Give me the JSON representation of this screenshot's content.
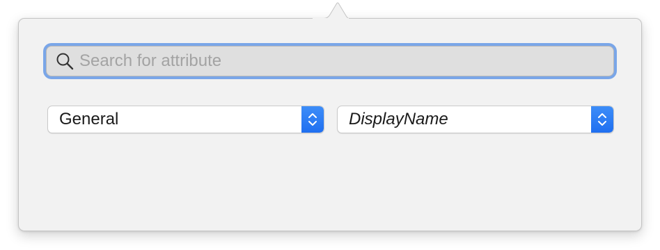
{
  "search": {
    "placeholder": "Search for attribute",
    "value": ""
  },
  "category_select": {
    "selected": "General"
  },
  "attribute_select": {
    "selected": "DisplayName"
  },
  "colors": {
    "focus_ring": "#6599e6",
    "stepper_blue": "#2a7cf5",
    "popover_bg": "#f2f2f2"
  },
  "icons": {
    "search": "magnifying-glass",
    "stepper": "chevron-up-down"
  }
}
